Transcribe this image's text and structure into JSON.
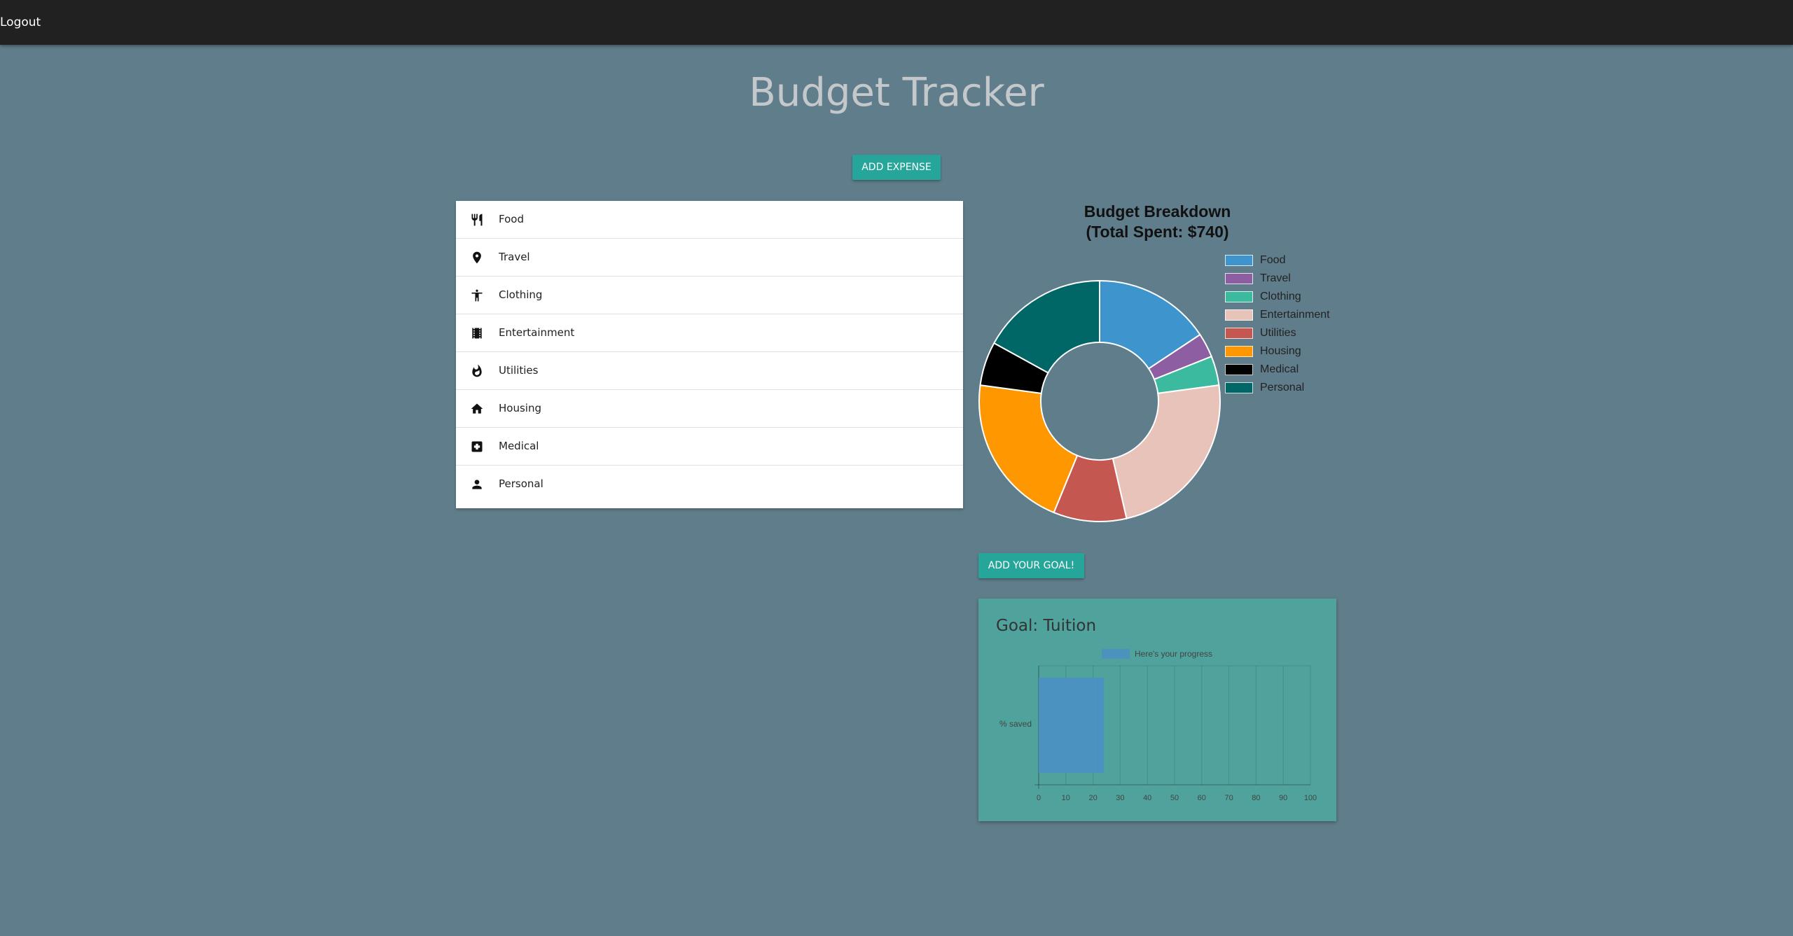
{
  "header": {
    "logout_label": "Logout"
  },
  "page": {
    "title": "Budget Tracker"
  },
  "actions": {
    "add_expense_label": "ADD EXPENSE",
    "add_goal_label": "ADD YOUR GOAL!"
  },
  "categories": [
    {
      "label": "Food",
      "icon": "restaurant-icon"
    },
    {
      "label": "Travel",
      "icon": "place-icon"
    },
    {
      "label": "Clothing",
      "icon": "accessibility-icon"
    },
    {
      "label": "Entertainment",
      "icon": "movie-icon"
    },
    {
      "label": "Utilities",
      "icon": "fire-icon"
    },
    {
      "label": "Housing",
      "icon": "home-icon"
    },
    {
      "label": "Medical",
      "icon": "medical-icon"
    },
    {
      "label": "Personal",
      "icon": "person-icon"
    }
  ],
  "chart_data": [
    {
      "type": "pie",
      "variant": "doughnut",
      "title_line1": "Budget Breakdown",
      "title_line2": "(Total Spent: $740)",
      "legend_position": "right",
      "categories": [
        "Food",
        "Travel",
        "Clothing",
        "Entertainment",
        "Utilities",
        "Housing",
        "Medical",
        "Personal"
      ],
      "values": [
        120,
        25,
        30,
        180,
        75,
        160,
        45,
        130
      ],
      "colors": [
        "#3e95cd",
        "#8e5ea2",
        "#3cba9f",
        "#e8c3b9",
        "#c45850",
        "#ff9800",
        "#000000",
        "#006666"
      ]
    },
    {
      "type": "bar",
      "orientation": "horizontal",
      "title": "Goal: Tuition",
      "legend_label": "Here's your progress",
      "categories": [
        "% saved"
      ],
      "values": [
        24
      ],
      "xlim": [
        0,
        100
      ],
      "x_ticks": [
        "0",
        "10",
        "20",
        "30",
        "40",
        "50",
        "60",
        "70",
        "80",
        "90",
        "100"
      ],
      "grid": true,
      "color": "#4a90c4"
    }
  ]
}
